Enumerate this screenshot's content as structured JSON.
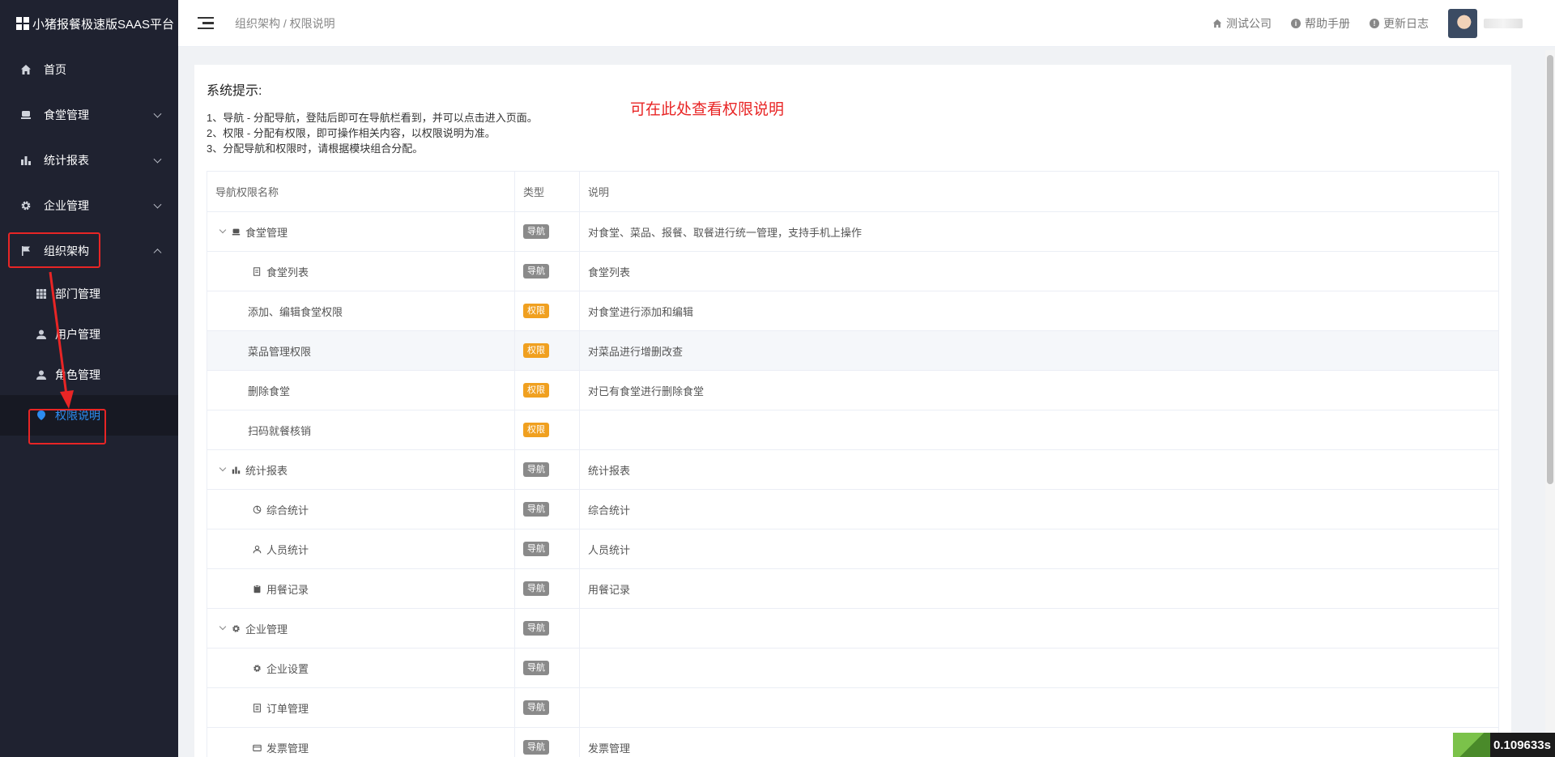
{
  "brand": {
    "title": "小猪报餐极速版SAAS平台"
  },
  "sidebar": {
    "items": [
      {
        "label": "首页",
        "icon": "home-icon"
      },
      {
        "label": "食堂管理",
        "icon": "canteen-icon"
      },
      {
        "label": "统计报表",
        "icon": "bar-chart-icon"
      },
      {
        "label": "企业管理",
        "icon": "gear-icon"
      },
      {
        "label": "组织架构",
        "icon": "flag-icon"
      }
    ],
    "subitems": [
      {
        "label": "部门管理",
        "icon": "grid-icon"
      },
      {
        "label": "用户管理",
        "icon": "user-icon"
      },
      {
        "label": "角色管理",
        "icon": "user-icon"
      },
      {
        "label": "权限说明",
        "icon": "pin-icon"
      }
    ]
  },
  "header": {
    "breadcrumb": "组织架构 / 权限说明",
    "links": [
      {
        "label": "测试公司",
        "icon": "home-icon"
      },
      {
        "label": "帮助手册",
        "icon": "info-icon"
      },
      {
        "label": "更新日志",
        "icon": "alert-icon"
      }
    ]
  },
  "tips": {
    "title": "系统提示:",
    "lines": [
      "1、导航 - 分配导航，登陆后即可在导航栏看到，并可以点击进入页面。",
      "2、权限 - 分配有权限，即可操作相关内容，以权限说明为准。",
      "3、分配导航和权限时，请根据模块组合分配。"
    ]
  },
  "annotation": "可在此处查看权限说明",
  "table": {
    "headers": [
      "导航权限名称",
      "类型",
      "说明"
    ],
    "rows": [
      {
        "name": "食堂管理",
        "type": "导航",
        "desc": "对食堂、菜品、报餐、取餐进行统一管理，支持手机上操作"
      },
      {
        "name": "食堂列表",
        "type": "导航",
        "desc": "食堂列表"
      },
      {
        "name": "添加、编辑食堂权限",
        "type": "权限",
        "desc": "对食堂进行添加和编辑"
      },
      {
        "name": "菜品管理权限",
        "type": "权限",
        "desc": "对菜品进行增删改查"
      },
      {
        "name": "删除食堂",
        "type": "权限",
        "desc": "对已有食堂进行删除食堂"
      },
      {
        "name": "扫码就餐核销",
        "type": "权限",
        "desc": ""
      },
      {
        "name": "统计报表",
        "type": "导航",
        "desc": "统计报表"
      },
      {
        "name": "综合统计",
        "type": "导航",
        "desc": "综合统计"
      },
      {
        "name": "人员统计",
        "type": "导航",
        "desc": "人员统计"
      },
      {
        "name": "用餐记录",
        "type": "导航",
        "desc": "用餐记录"
      },
      {
        "name": "企业管理",
        "type": "导航",
        "desc": ""
      },
      {
        "name": "企业设置",
        "type": "导航",
        "desc": ""
      },
      {
        "name": "订单管理",
        "type": "导航",
        "desc": ""
      },
      {
        "name": "发票管理",
        "type": "导航",
        "desc": "发票管理"
      }
    ]
  },
  "timer": "0.109633s",
  "colors": {
    "sidebar_bg": "#1f2230",
    "active_blue": "#2d8cf0",
    "nav_badge": "#8a8a8a",
    "perm_badge": "#f0a020",
    "annotation_red": "#e82525"
  }
}
